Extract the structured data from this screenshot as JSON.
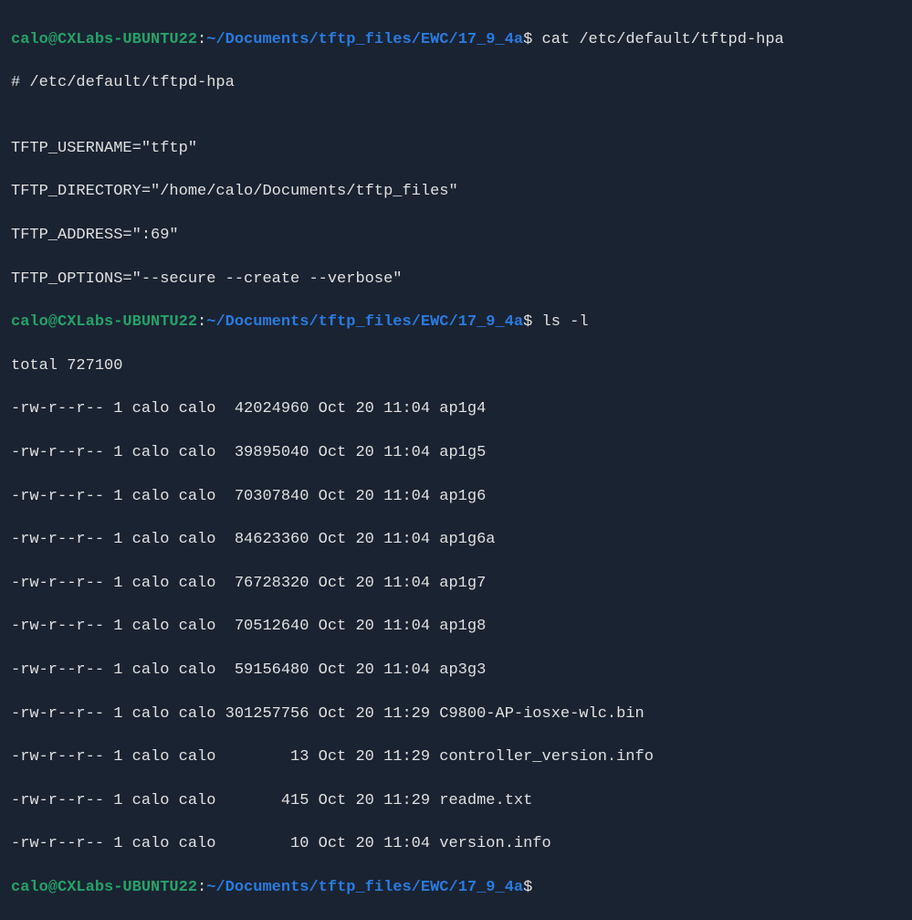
{
  "prompt": {
    "user_host": "calo@CXLabs-UBUNTU22",
    "colon": ":",
    "path": "~/Documents/tftp_files/EWC/17_9_4a",
    "dollar": "$"
  },
  "commands": {
    "cat": "cat /etc/default/tftpd-hpa",
    "ls": "ls -l",
    "empty": ""
  },
  "cat_output": {
    "comment": "# /etc/default/tftpd-hpa",
    "blank": "",
    "username": "TFTP_USERNAME=\"tftp\"",
    "directory": "TFTP_DIRECTORY=\"/home/calo/Documents/tftp_files\"",
    "address": "TFTP_ADDRESS=\":69\"",
    "options": "TFTP_OPTIONS=\"--secure --create --verbose\""
  },
  "ls_output": {
    "total": "total 727100",
    "rows": [
      "-rw-r--r-- 1 calo calo  42024960 Oct 20 11:04 ap1g4",
      "-rw-r--r-- 1 calo calo  39895040 Oct 20 11:04 ap1g5",
      "-rw-r--r-- 1 calo calo  70307840 Oct 20 11:04 ap1g6",
      "-rw-r--r-- 1 calo calo  84623360 Oct 20 11:04 ap1g6a",
      "-rw-r--r-- 1 calo calo  76728320 Oct 20 11:04 ap1g7",
      "-rw-r--r-- 1 calo calo  70512640 Oct 20 11:04 ap1g8",
      "-rw-r--r-- 1 calo calo  59156480 Oct 20 11:04 ap3g3",
      "-rw-r--r-- 1 calo calo 301257756 Oct 20 11:29 C9800-AP-iosxe-wlc.bin",
      "-rw-r--r-- 1 calo calo        13 Oct 20 11:29 controller_version.info",
      "-rw-r--r-- 1 calo calo       415 Oct 20 11:29 readme.txt",
      "-rw-r--r-- 1 calo calo        10 Oct 20 11:04 version.info"
    ]
  }
}
